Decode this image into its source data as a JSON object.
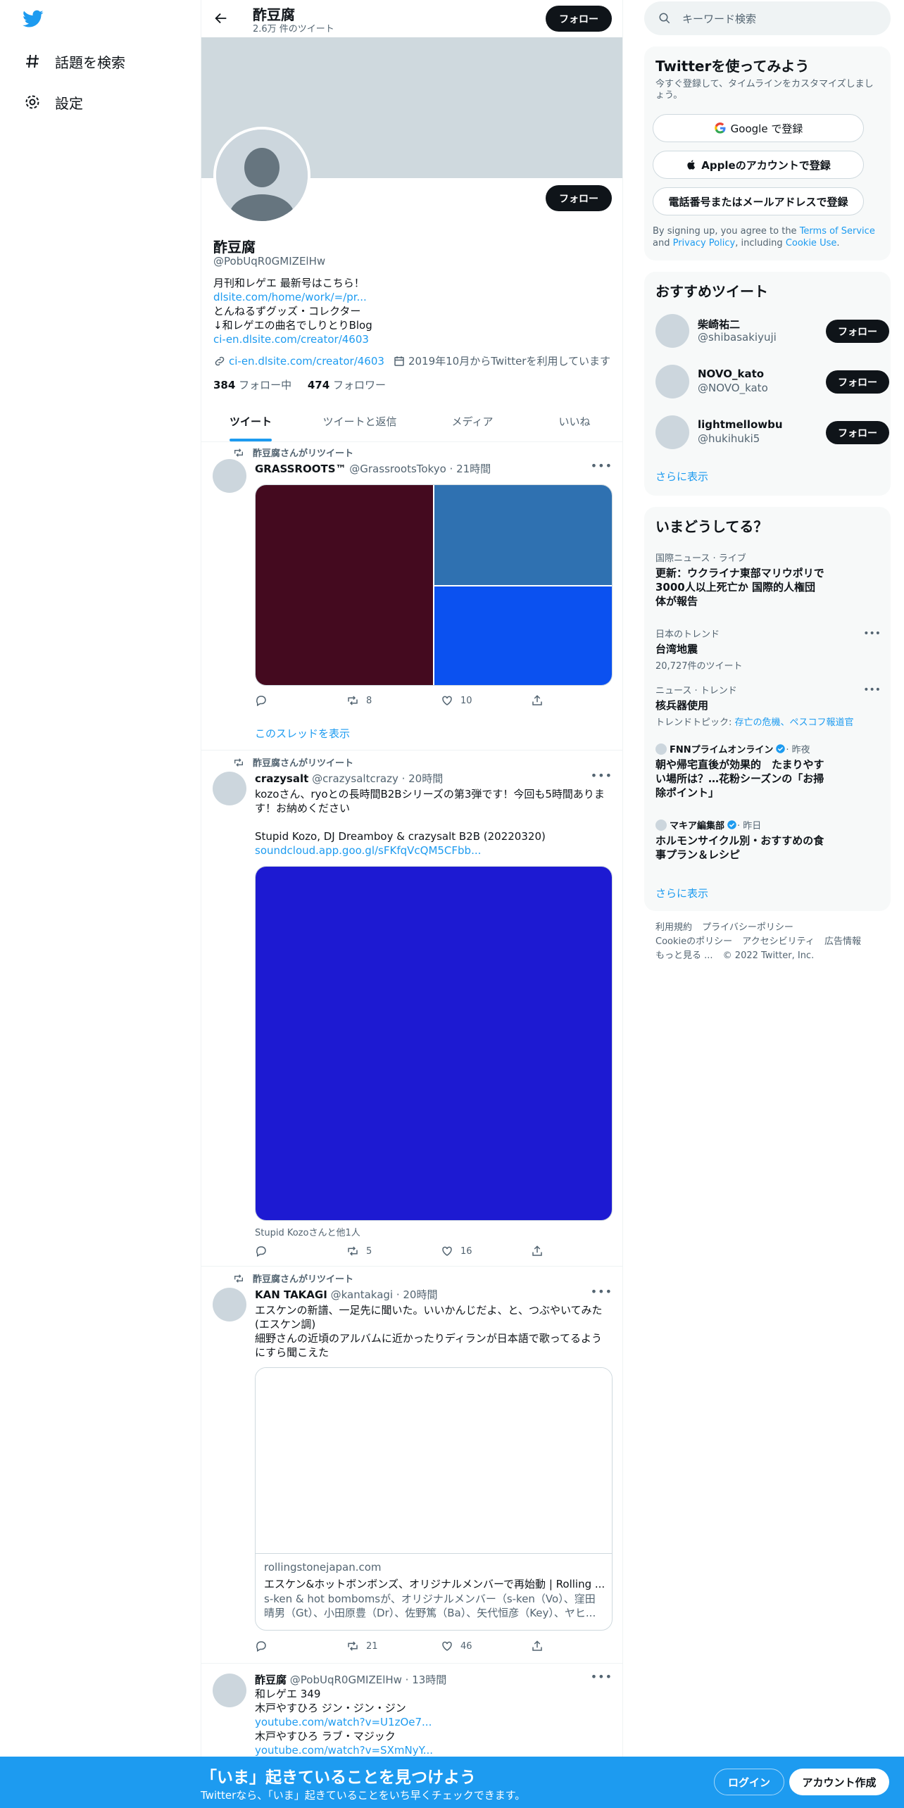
{
  "nav": {
    "explore": "話題を検索",
    "settings": "設定"
  },
  "profile": {
    "top_name": "酢豆腐",
    "top_count": "2.6万 件のツイート",
    "follow_label": "フォロー",
    "name": "酢豆腐",
    "handle": "@PobUqR0GMIZElHw",
    "bio": [
      "月刊和レゲエ 最新号はこちら！",
      "dlsite.com/home/work/=/pr...",
      "とんねるずグッズ・コレクター",
      "↓和レゲエの曲名でしりとりBlog",
      "ci-en.dlsite.com/creator/4603"
    ],
    "website": "ci-en.dlsite.com/creator/4603",
    "joined": "2019年10月からTwitterを利用しています",
    "following_count": "384",
    "following_label": " フォロー中",
    "followers_count": "474",
    "followers_label": " フォロワー"
  },
  "tabs": [
    "ツイート",
    "ツイートと返信",
    "メディア",
    "いいね"
  ],
  "tweets": [
    {
      "retweeted_by": "酢豆腐さんがリツイート",
      "name": "GRASSROOTS™",
      "meta": " @GrassrootsTokyo · 21時間",
      "retweets": "8",
      "likes": "10",
      "show_thread": "このスレッドを表示",
      "media_colors": [
        "#440a1f",
        "#2f71b1",
        "#0b51f0"
      ]
    },
    {
      "retweeted_by": "酢豆腐さんがリツイート",
      "name": "crazysalt",
      "meta": " @crazysaltcrazy · 20時間",
      "text1": "kozoさん、ryoとの長時間B2Bシリーズの第3弾です！今回も5時間あります！お納めください",
      "text2": "Stupid Kozo, DJ Dreamboy & crazysalt B2B (20220320)",
      "link": "soundcloud.app.goo.gl/sFKfqVcQM5CFbb...",
      "media_caption": "Stupid Kozoさんと他1人",
      "media_color": "#1d1ad2",
      "retweets": "5",
      "likes": "16"
    },
    {
      "retweeted_by": "酢豆腐さんがリツイート",
      "name": "KAN TAKAGI",
      "meta": " @kantakagi · 20時間",
      "text1": "エスケンの新譜、一足先に聞いた。いいかんじだよ、と、つぶやいてみた(エスケン調)",
      "text2": "細野さんの近頃のアルバムに近かったりディランが日本語で歌ってるようにすら聞こえた",
      "card_domain": "rollingstonejapan.com",
      "card_title": "エスケン&ホットボンボンズ、オリジナルメンバーで再始動 | Rolling ...",
      "card_desc": "s-ken & hot bombomsが、オリジナルメンバー（s-ken（Vo）、窪田晴男（Gt）、小田原豊（Dr）、佐野篤（Ba）、矢代恒彦（Key）、ヤヒ...",
      "retweets": "21",
      "likes": "46"
    },
    {
      "name": "酢豆腐",
      "meta": " @PobUqR0GMIZElHw · 13時間",
      "lines": [
        "和レゲエ 349",
        "木戸やすひろ ジン・ジン・ジン",
        "youtube.com/watch?v=U1zOe7...",
        "木戸やすひろ ラブ・マジック",
        "youtube.com/watch?v=SXmNyY..."
      ]
    }
  ],
  "right": {
    "search_placeholder": "キーワード検索",
    "signup_title": "Twitterを使ってみよう",
    "signup_sub": "今すぐ登録して、タイムラインをカスタマイズしましょう。",
    "google_btn": "Google で登録",
    "apple_btn": "Appleのアカウントで登録",
    "phone_btn": "電話番号またはメールアドレスで登録",
    "terms_1": "By signing up, you agree to the ",
    "terms_link1": "Terms of Service",
    "terms_2": " and ",
    "terms_link2": "Privacy Policy",
    "terms_3": ", including ",
    "terms_link3": "Cookie Use",
    "terms_4": ".",
    "rec_title": "おすすめツイート",
    "recs": [
      {
        "name": "柴崎祐二",
        "handle": "@shibasakiyuji"
      },
      {
        "name": "NOVO_kato",
        "handle": "@NOVO_kato"
      },
      {
        "name": "lightmellowbu",
        "handle": "@hukihuki5"
      }
    ],
    "follow_label": "フォロー",
    "show_more": "さらに表示",
    "trends_title": "いまどうしてる？",
    "trends": [
      {
        "category": "国際ニュース · ライブ",
        "title": "更新：ウクライナ東部マリウポリで3000人以上死亡か 国際的人権団体が報告"
      },
      {
        "category": "日本のトレンド",
        "title": "台湾地震",
        "sub": "20,727件のツイート"
      },
      {
        "category": "ニュース · トレンド",
        "title": "核兵器使用",
        "sub_prefix": "トレンドトピック: ",
        "sub_link": "存亡の危機、ペスコフ報道官"
      },
      {
        "source": "FNNプライムオンライン",
        "time": " · 昨夜",
        "title": "朝や帰宅直後が効果的　たまりやすい場所は？…花粉シーズンの「お掃除ポイント」"
      },
      {
        "source": "マキア編集部",
        "time": " · 昨日",
        "title": "ホルモンサイクル別・おすすめの食事プラン＆レシピ"
      }
    ],
    "footer": [
      "利用規約",
      "プライバシーポリシー",
      "Cookieのポリシー",
      "アクセシビリティ",
      "広告情報",
      "もっと見る ...",
      "© 2022 Twitter, Inc."
    ]
  },
  "bottom": {
    "title": "「いま」起きていることを見つけよう",
    "subtitle": "Twitterなら、「いま」起きていることをいち早くチェックできます。",
    "login": "ログイン",
    "signup": "アカウント作成"
  },
  "colors": {
    "accent": "#1d9bf0",
    "dark": "#0f1419",
    "banner": "#cfd9de"
  }
}
